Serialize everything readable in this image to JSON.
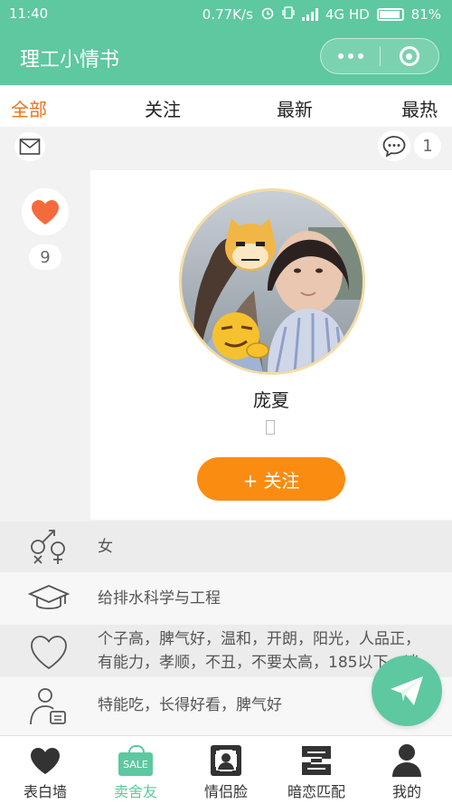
{
  "status_bar": {
    "time": "11:40",
    "network_speed": "0.77K/s",
    "network_type": "4G HD",
    "battery": "81%"
  },
  "app": {
    "title": "理工小情书",
    "accent_color": "#5ec8a0",
    "highlight_color": "#e8731c",
    "follow_button_color": "#fb8c12"
  },
  "tabs": [
    {
      "label": "全部",
      "active": true
    },
    {
      "label": "关注",
      "active": false
    },
    {
      "label": "最新",
      "active": false
    },
    {
      "label": "最热",
      "active": false
    }
  ],
  "toolbar": {
    "message_count": "1"
  },
  "profile": {
    "like_count": "9",
    "name": "庞夏",
    "follow_label": "+ 关注",
    "gender": "女",
    "major": "给排水科学与工程",
    "ideal_line1": "个子高，脾气好，温和，开朗，阳光，人品正，",
    "ideal_line2": "有能力，孝顺，不丑，不要太高，185以下，谈",
    "skills": "特能吃，长得好看，脾气好"
  },
  "bottom_nav": [
    {
      "label": "表白墙",
      "icon": "heart-icon",
      "active": false
    },
    {
      "label": "卖舍友",
      "icon": "sale-tag-icon",
      "badge": "SALE",
      "active": true
    },
    {
      "label": "情侣脸",
      "icon": "face-scan-icon",
      "active": false
    },
    {
      "label": "暗恋匹配",
      "icon": "match-icon",
      "active": false
    },
    {
      "label": "我的",
      "icon": "person-icon",
      "active": false
    }
  ]
}
